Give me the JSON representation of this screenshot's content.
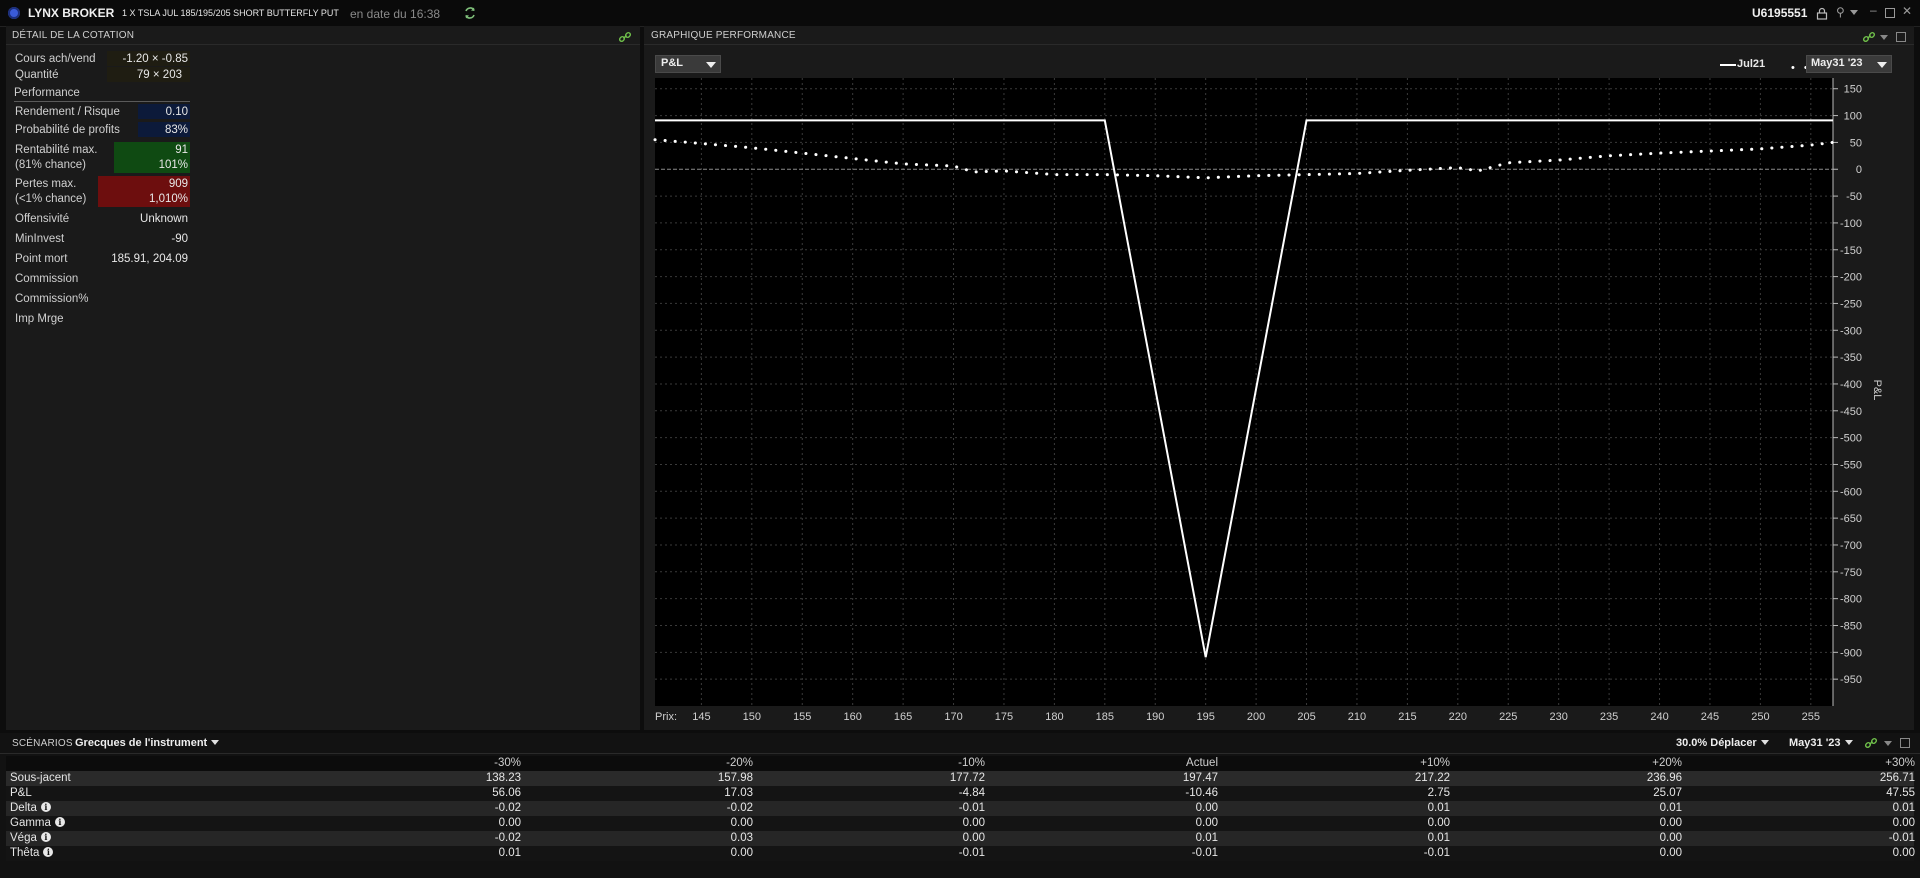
{
  "app": {
    "name": "LYNX BROKER",
    "instrument": "1 X TSLA JUL 185/195/205 SHORT BUTTERFLY PUT",
    "timestamp": "en date du 16:38",
    "account": "U6195551"
  },
  "quote_panel": {
    "title": "DÉTAIL DE LA COTATION",
    "bid_ask_label": "Cours ach/vend",
    "bid_ask_value": "-1.20 × -0.85",
    "qty_label": "Quantité",
    "qty_value": "79 × 203",
    "performance_label": "Performance",
    "rr_label": "Rendement / Risque",
    "rr_value": "0.10",
    "prob_label": "Probabilité de profits",
    "prob_value": "83%",
    "maxprofit_label1": "Rentabilité max.",
    "maxprofit_label2": "(81% chance)",
    "maxprofit_value1": "91",
    "maxprofit_value2": "101%",
    "maxloss_label1": "Pertes max.",
    "maxloss_label2": "(<1% chance)",
    "maxloss_value1": "909",
    "maxloss_value2": "1,010%",
    "offensive_label": "Offensivité",
    "offensive_value": "Unknown",
    "mininvest_label": "MinInvest",
    "mininvest_value": "-90",
    "breakeven_label": "Point mort",
    "breakeven_value": "185.91, 204.09",
    "commission_label": "Commission",
    "commission_pct_label": "Commission%",
    "margin_label": "Imp Mrge"
  },
  "perf_panel": {
    "title": "GRAPHIQUE PERFORMANCE",
    "metric_select": "P&L",
    "legend_jul": "Jul21",
    "legend_date_select": "May31 '23"
  },
  "chart_data": {
    "type": "line",
    "xlabel": "Prix:",
    "ylabel": "P&L",
    "xlim": [
      140.4,
      257.2
    ],
    "ylim": [
      -1000,
      170
    ],
    "x_ticks": [
      145,
      150,
      155,
      160,
      165,
      170,
      175,
      180,
      185,
      190,
      195,
      200,
      205,
      210,
      215,
      220,
      225,
      230,
      235,
      240,
      245,
      250,
      255
    ],
    "y_ticks": [
      150,
      100,
      50,
      0,
      -50,
      -100,
      -150,
      -200,
      -250,
      -300,
      -350,
      -400,
      -450,
      -500,
      -550,
      -600,
      -650,
      -700,
      -750,
      -800,
      -850,
      -900,
      -950
    ],
    "series": [
      {
        "name": "Jul21",
        "style": "solid",
        "x": [
          140.4,
          185,
          195,
          205,
          257.2
        ],
        "y": [
          91,
          91,
          -909,
          91,
          91
        ]
      },
      {
        "name": "May31 '23",
        "style": "dotted",
        "x": [
          140.4,
          145,
          150,
          155,
          160,
          165,
          170,
          172,
          175,
          180,
          185,
          190,
          195,
          200,
          205,
          210,
          215,
          220,
          222,
          225,
          230,
          235,
          240,
          245,
          250,
          255,
          257.2
        ],
        "y": [
          55,
          48,
          40,
          30,
          20,
          10,
          6,
          -5,
          -3,
          -10,
          -10,
          -12,
          -16,
          -12,
          -10,
          -8,
          -2,
          3,
          -3,
          12,
          17,
          25,
          30,
          34,
          38,
          45,
          50
        ]
      }
    ]
  },
  "scenarios": {
    "title": "SCÉNARIOS",
    "greeks_select": "Grecques de l'instrument",
    "move_select": "30.0% Déplacer",
    "date_select": "May31 '23",
    "columns": [
      "-30%",
      "-20%",
      "-10%",
      "Actuel",
      "+10%",
      "+20%",
      "+30%"
    ],
    "rows": [
      {
        "label": "Sous-jacent",
        "info": false,
        "values": [
          "138.23",
          "157.98",
          "177.72",
          "197.47",
          "217.22",
          "236.96",
          "256.71"
        ]
      },
      {
        "label": "P&L",
        "info": false,
        "values": [
          "56.06",
          "17.03",
          "-4.84",
          "-10.46",
          "2.75",
          "25.07",
          "47.55"
        ]
      },
      {
        "label": "Delta",
        "info": true,
        "values": [
          "-0.02",
          "-0.02",
          "-0.01",
          "0.00",
          "0.01",
          "0.01",
          "0.01"
        ]
      },
      {
        "label": "Gamma",
        "info": true,
        "values": [
          "0.00",
          "0.00",
          "0.00",
          "0.00",
          "0.00",
          "0.00",
          "0.00"
        ]
      },
      {
        "label": "Véga",
        "info": true,
        "values": [
          "-0.02",
          "0.03",
          "0.00",
          "0.01",
          "0.01",
          "0.00",
          "-0.01"
        ]
      },
      {
        "label": "Thêta",
        "info": true,
        "values": [
          "0.01",
          "0.00",
          "-0.01",
          "-0.01",
          "-0.01",
          "0.00",
          "0.00"
        ]
      }
    ]
  },
  "colors": {
    "accent_blue": "#3a5bd9",
    "profit_green": "#0f4a12",
    "loss_red": "#6d0e0e",
    "value_navy": "#0c1a3a",
    "link_green": "#6fbf4a"
  }
}
